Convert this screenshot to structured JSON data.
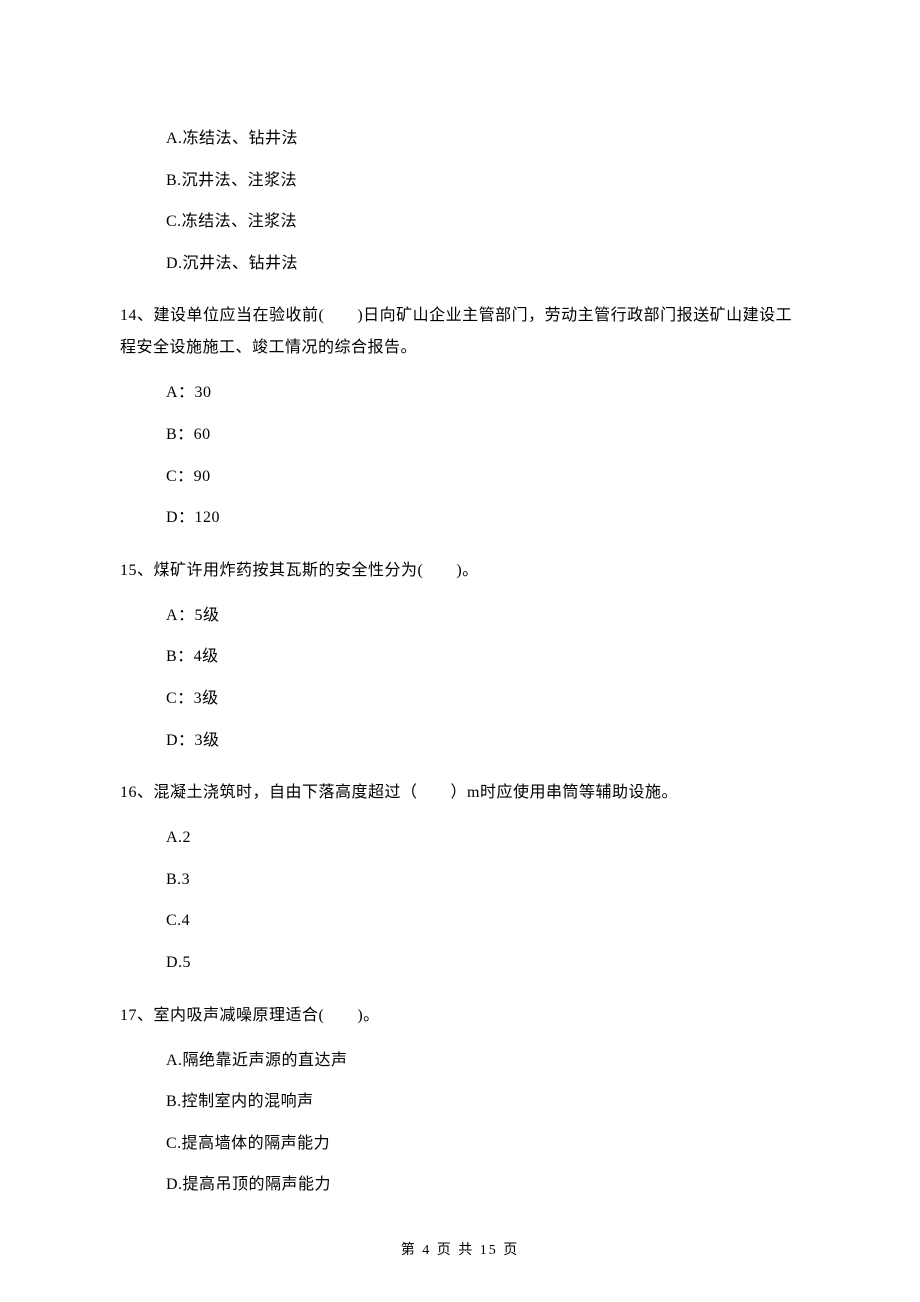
{
  "q13": {
    "options": {
      "a": "A.冻结法、钻井法",
      "b": "B.沉井法、注浆法",
      "c": "C.冻结法、注浆法",
      "d": "D.沉井法、钻井法"
    }
  },
  "q14": {
    "text": "14、建设单位应当在验收前(　　)日向矿山企业主管部门，劳动主管行政部门报送矿山建设工程安全设施施工、竣工情况的综合报告。",
    "options": {
      "a": "A：30",
      "b": "B：60",
      "c": "C：90",
      "d": "D：120"
    }
  },
  "q15": {
    "text": "15、煤矿许用炸药按其瓦斯的安全性分为(　　)。",
    "options": {
      "a": "A：5级",
      "b": "B：4级",
      "c": "C：3级",
      "d": "D：3级"
    }
  },
  "q16": {
    "text": "16、混凝土浇筑时，自由下落高度超过（　　）m时应使用串筒等辅助设施。",
    "options": {
      "a": "A.2",
      "b": "B.3",
      "c": "C.4",
      "d": "D.5"
    }
  },
  "q17": {
    "text": "17、室内吸声减噪原理适合(　　)。",
    "options": {
      "a": "A.隔绝靠近声源的直达声",
      "b": "B.控制室内的混响声",
      "c": "C.提高墙体的隔声能力",
      "d": "D.提高吊顶的隔声能力"
    }
  },
  "footer": "第 4 页 共 15 页"
}
